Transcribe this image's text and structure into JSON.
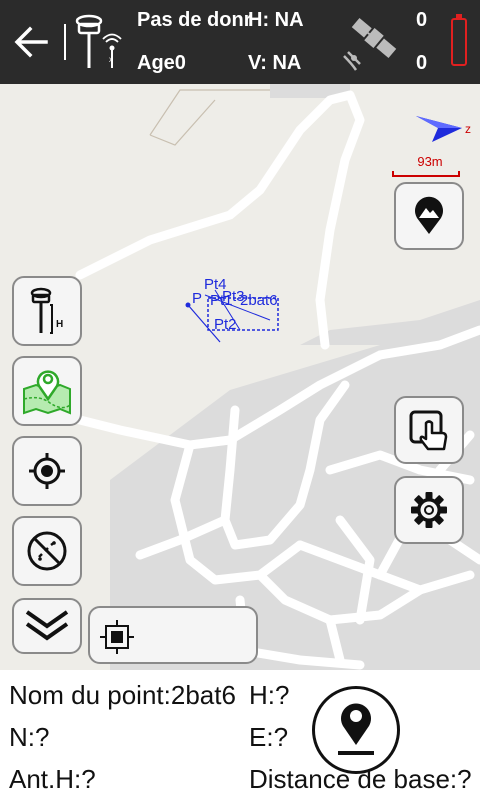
{
  "header": {
    "back_icon": "arrow-left-icon",
    "rover_icon": "gnss-rover-icon",
    "status": "Pas de donr",
    "h_precision": "H: NA",
    "age": "Age0",
    "v_precision": "V: NA",
    "satellite_icon": "satellite-icon",
    "sats_top": "0",
    "sats_bottom": "0",
    "battery_icon": "battery-icon",
    "battery_color": "#e02020"
  },
  "map": {
    "scale_label": "93m",
    "north_arrow_icon": "compass-arrow-icon",
    "north_letter": "z",
    "point_labels": [
      "Pt4",
      "Pt1",
      "P",
      "Pt2",
      "Pt3",
      "2bat6"
    ],
    "point_color": "#1f2bdc"
  },
  "buttons": {
    "landmark": "mountain-pin-icon",
    "antenna": "rover-height-icon",
    "antenna_letter": "H",
    "map_layers": "map-pin-layer-icon",
    "locate": "crosshair-icon",
    "no_track": "no-track-icon",
    "collapse": "double-chevron-down-icon",
    "coord_target": "target-square-icon",
    "touch": "touch-hand-icon",
    "settings": "gear-icon",
    "collect": "collect-point-icon"
  },
  "info": {
    "point_name": "Nom du point:2bat6",
    "h": "H:?",
    "n": "N:?",
    "e": "E:?",
    "ant_h": "Ant.H:?",
    "base_distance": "Distance de base:?"
  }
}
